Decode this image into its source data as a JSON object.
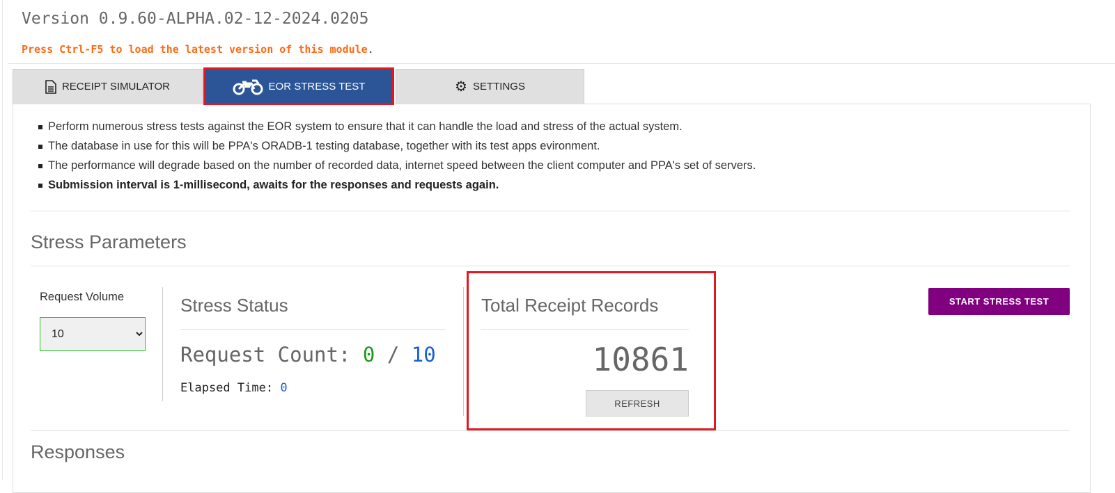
{
  "header": {
    "version": "Version 0.9.60-ALPHA.02-12-2024.0205",
    "notice": "Press Ctrl-F5 to load the latest version of this module",
    "notice_end": "."
  },
  "tabs": [
    {
      "label": "RECEIPT SIMULATOR",
      "icon": "document-icon"
    },
    {
      "label": "EOR STRESS TEST",
      "icon": "motorcycle-icon",
      "active": true
    },
    {
      "label": "SETTINGS",
      "icon": "gear-icon"
    }
  ],
  "info": [
    "Perform numerous stress tests against the EOR system to ensure that it can handle the load and stress of the actual system.",
    "The database in use for this will be PPA's ORADB-1 testing database, together with its test apps evironment.",
    "The performance will degrade based on the number of recorded data, internet speed between the client computer and PPA's set of servers.",
    "Submission interval is 1-millisecond, awaits for the responses and requests again."
  ],
  "params": {
    "title": "Stress Parameters",
    "volume_label": "Request Volume",
    "volume_value": "10"
  },
  "status": {
    "title": "Stress Status",
    "count_label": "Request Count:",
    "count_done": "0",
    "sep": "/",
    "count_total": "10",
    "elapsed_label": "Elapsed Time:",
    "elapsed_value": "0"
  },
  "records": {
    "title": "Total Receipt Records",
    "value": "10861",
    "refresh_label": "REFRESH"
  },
  "start_label": "START STRESS TEST",
  "responses_title": "Responses",
  "colors": {
    "accent": "#2b5597",
    "start": "#800080",
    "highlight": "#e4161f",
    "done": "#1a9a1a",
    "total": "#1a5fd0"
  }
}
